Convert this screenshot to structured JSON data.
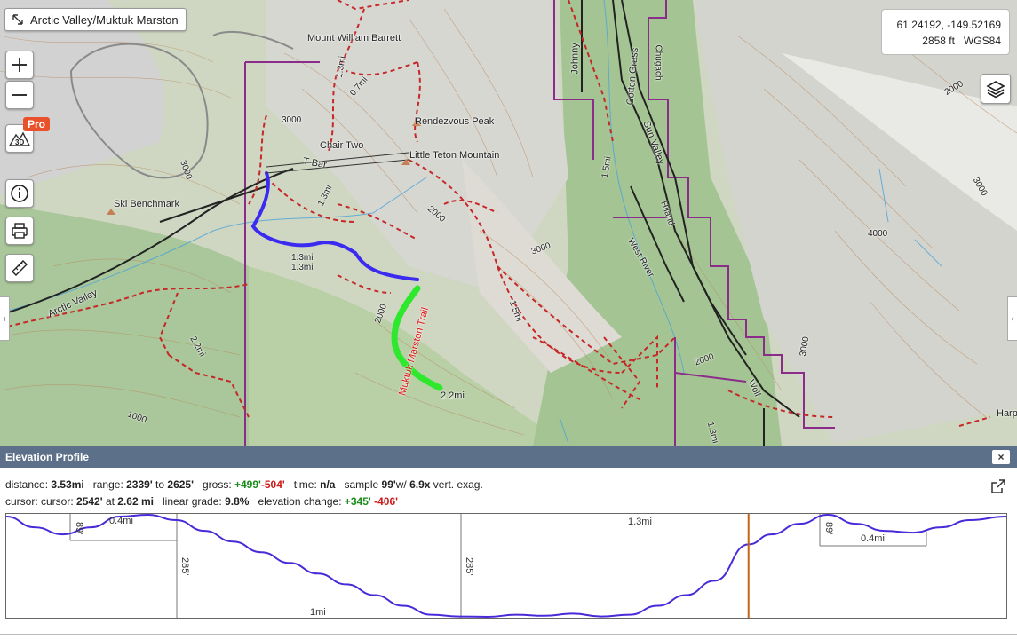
{
  "map": {
    "title": "Arctic Valley/Muktuk Marston",
    "coords_line1": "61.24192, -149.52169",
    "coords_line2": "2858 ft   WGS84",
    "pro_label": "Pro",
    "threed_label": "3D",
    "labels": {
      "mount_william_barrett": "Mount William Barrett",
      "rendezvous_peak": "Rendezvous Peak",
      "little_teton": "Little Teton Mountain",
      "chair_two": "Chair Two",
      "t_bar": "T-Bar",
      "ski_benchmark": "Ski Benchmark",
      "arctic_valley": "Arctic Valley",
      "muktuk_marston": "Muktuk Marston Trail",
      "johnny": "Johnny",
      "cotton_grass": "Cotton Grass",
      "chugach": "Chugach",
      "sun_valley": "Sun Valley",
      "hiland": "Hiland",
      "west_river": "West River",
      "wolf": "Wolf",
      "harp": "Harp",
      "d_1_3mi_a": "1.3mi",
      "d_0_7mi": "0.7mi",
      "d_1_3mi_b": "1.3mi",
      "d_1_3mi_c": "1.3mi",
      "d_1_3mi_d": "1.3mi",
      "d_1_5mi_a": "1.5mi",
      "d_1_5mi_b": "1.5mi",
      "d_2_2mi_a": "2.2mi",
      "d_2_2mi_b": "2.2mi",
      "d_1_3mi_e": "1.3mi",
      "c3000a": "3000",
      "c3000b": "3000",
      "c3000c": "3000",
      "c3000d": "3000",
      "c3000e": "3000",
      "c2000a": "2000",
      "c2000b": "2000",
      "c2000c": "2000",
      "c2000d": "2000",
      "c4000": "4000",
      "c1000": "1000"
    }
  },
  "profile": {
    "header": "Elevation Profile",
    "close_label": "×",
    "distance_label": "distance:",
    "distance_value": "3.53mi",
    "range_label": "range:",
    "range_low": "2339'",
    "range_to": "to",
    "range_high": "2625'",
    "gross_label": "gross:",
    "gross_up": "+499'",
    "gross_down": "-504'",
    "time_label": "time:",
    "time_value": "n/a",
    "sample_label": "sample",
    "sample_value": "99'",
    "vert_label": "w/",
    "vert_value": "6.9x",
    "vert_suffix": "vert. exag.",
    "cursor_label": "cursor: cursor:",
    "cursor_elev": "2542'",
    "cursor_at": "at",
    "cursor_dist": "2.62 mi",
    "grade_label": "linear grade:",
    "grade_value": "9.8%",
    "change_label": "elevation change:",
    "change_up": "+345'",
    "change_down": "-406'",
    "chart_labels": {
      "seg_a": "0.4mi",
      "seg_b": "1mi",
      "seg_c": "1.3mi",
      "seg_d": "0.4mi",
      "v1": "89'",
      "v2": "285'",
      "v3": "285'",
      "v4": "89'"
    }
  },
  "chart_data": {
    "type": "line",
    "x": [
      0,
      0.1,
      0.2,
      0.3,
      0.4,
      0.5,
      0.6,
      0.7,
      0.8,
      0.9,
      1.0,
      1.1,
      1.2,
      1.3,
      1.4,
      1.5,
      1.6,
      1.7,
      1.8,
      1.9,
      2.0,
      2.1,
      2.2,
      2.3,
      2.4,
      2.5,
      2.62,
      2.7,
      2.8,
      2.9,
      3.0,
      3.1,
      3.2,
      3.3,
      3.4,
      3.53
    ],
    "y": [
      2620,
      2590,
      2570,
      2590,
      2620,
      2625,
      2610,
      2580,
      2550,
      2520,
      2490,
      2460,
      2430,
      2400,
      2370,
      2345,
      2340,
      2339,
      2345,
      2342,
      2348,
      2340,
      2345,
      2370,
      2400,
      2440,
      2542,
      2570,
      2600,
      2625,
      2600,
      2580,
      2575,
      2590,
      2610,
      2620
    ],
    "ylim": [
      2339,
      2625
    ]
  }
}
